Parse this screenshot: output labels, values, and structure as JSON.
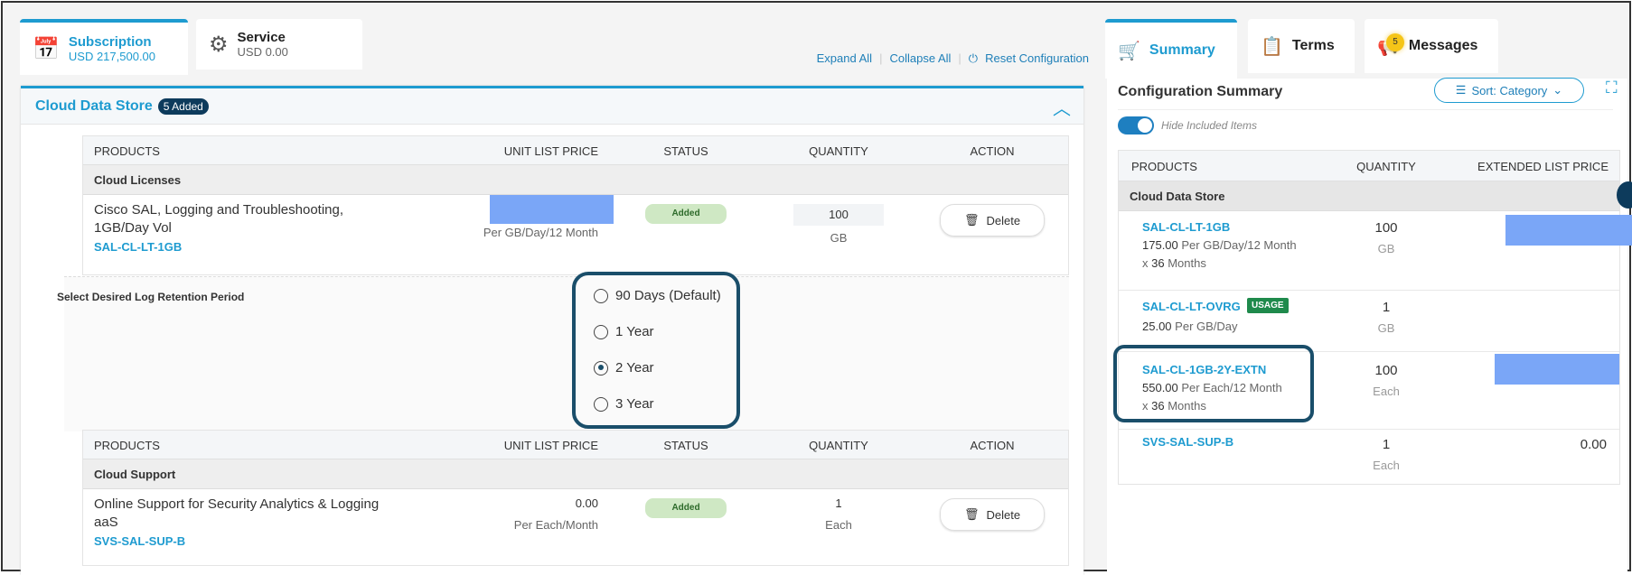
{
  "tabs": {
    "subscription": {
      "label": "Subscription",
      "amount": "USD 217,500.00"
    },
    "service": {
      "label": "Service",
      "amount": "USD 0.00"
    }
  },
  "links": {
    "expand": "Expand All",
    "collapse": "Collapse All",
    "reset": "Reset Configuration"
  },
  "section": {
    "title": "Cloud Data Store",
    "badge": "5 Added"
  },
  "columns": {
    "products": "PRODUCTS",
    "unit_price": "UNIT LIST PRICE",
    "status": "STATUS",
    "quantity": "QUANTITY",
    "action": "ACTION"
  },
  "table1": {
    "group": "Cloud Licenses",
    "item": {
      "name_line1": "Cisco SAL, Logging and Troubleshooting,",
      "name_line2": "1GB/Day Vol",
      "sku": "SAL-CL-LT-1GB",
      "price_unit": "Per GB/Day/12 Month",
      "status": "Added",
      "quantity": "100",
      "qty_unit": "GB",
      "action": "Delete"
    }
  },
  "retention": {
    "label": "Select Desired Log Retention Period",
    "options": [
      "90 Days (Default)",
      "1 Year",
      "2 Year",
      "3 Year"
    ],
    "selected": "2 Year"
  },
  "table2": {
    "group": "Cloud Support",
    "item": {
      "name_line1": "Online Support for Security Analytics & Logging",
      "name_line2": "aaS",
      "sku": "SVS-SAL-SUP-B",
      "price": "0.00",
      "price_unit": "Per Each/Month",
      "status": "Added",
      "quantity": "1",
      "qty_unit": "Each",
      "action": "Delete"
    }
  },
  "right_tabs": {
    "summary": "Summary",
    "terms": "Terms",
    "messages": "Messages",
    "messages_count": "5"
  },
  "summary": {
    "title": "Configuration Summary",
    "sort": "Sort: Category",
    "toggle_label": "Hide Included Items",
    "toggle_on": true,
    "columns": {
      "products": "PRODUCTS",
      "quantity": "QUANTITY",
      "ext_price": "EXTENDED LIST PRICE"
    },
    "group": "Cloud Data Store",
    "rows": [
      {
        "sku": "SAL-CL-LT-1GB",
        "price": "175.00",
        "price_unit": "Per GB/Day/12 Month",
        "term_x": "x",
        "term": "36",
        "term_unit": "Months",
        "qty": "100",
        "qty_unit": "GB"
      },
      {
        "sku": "SAL-CL-LT-OVRG",
        "tag": "USAGE",
        "price": "25.00",
        "price_unit": "Per GB/Day",
        "qty": "1",
        "qty_unit": "GB"
      },
      {
        "sku": "SAL-CL-1GB-2Y-EXTN",
        "price": "550.00",
        "price_unit": "Per Each/12 Month",
        "term_x": "x",
        "term": "36",
        "term_unit": "Months",
        "qty": "100",
        "qty_unit": "Each"
      },
      {
        "sku": "SVS-SAL-SUP-B",
        "qty": "1",
        "qty_unit": "Each",
        "ext": "0.00"
      }
    ]
  },
  "colors": {
    "accent": "#1e9bd0",
    "highlight": "#1a4e6a",
    "redaction": "#7aa6f7",
    "added": "#cfe8c4",
    "usage": "#1f8a4c"
  }
}
